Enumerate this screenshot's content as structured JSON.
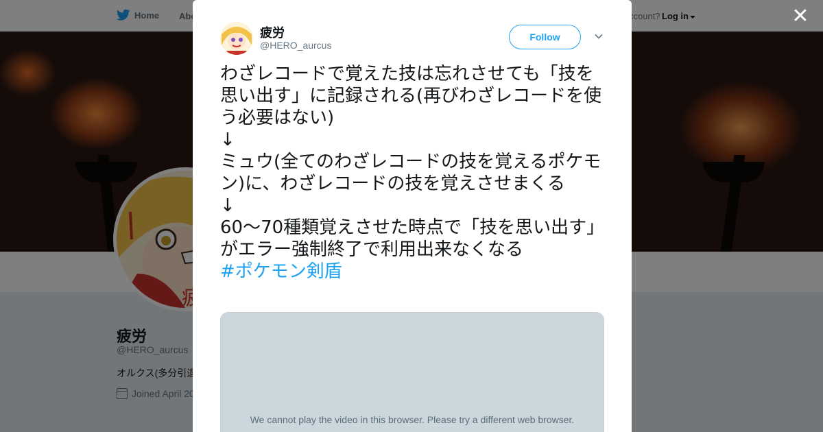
{
  "nav": {
    "home_label": "Home",
    "about_label": "Abo",
    "account_label": "ccount?",
    "login_label": "Log in"
  },
  "profile": {
    "name": "疲労",
    "handle": "@HERO_aurcus",
    "bio": "オルクス(多分引退",
    "joined": "Joined April 20"
  },
  "tweet": {
    "author_name": "疲労",
    "author_handle": "@HERO_aurcus",
    "follow_label": "Follow",
    "text": "わざレコードで覚えた技は忘れさせても「技を思い出す」に記録される(再びわざレコードを使う必要はない)\n↓\nミュウ(全てのわざレコードの技を覚えるポケモン)に、わざレコードの技を覚えさせまくる\n↓\n60～70種類覚えさせた時点で「技を思い出す」がエラー強制終了で利用出来なくなる",
    "hashtag": "#ポケモン剣盾",
    "video_message": "We cannot play the video in this browser. Please try a different web browser."
  },
  "colors": {
    "accent": "#1da1f2",
    "text": "#14171a",
    "muted": "#657786"
  },
  "icons": {
    "brand": "twitter-bird-icon",
    "close": "close-icon",
    "more": "chevron-down-icon",
    "calendar": "calendar-icon"
  }
}
